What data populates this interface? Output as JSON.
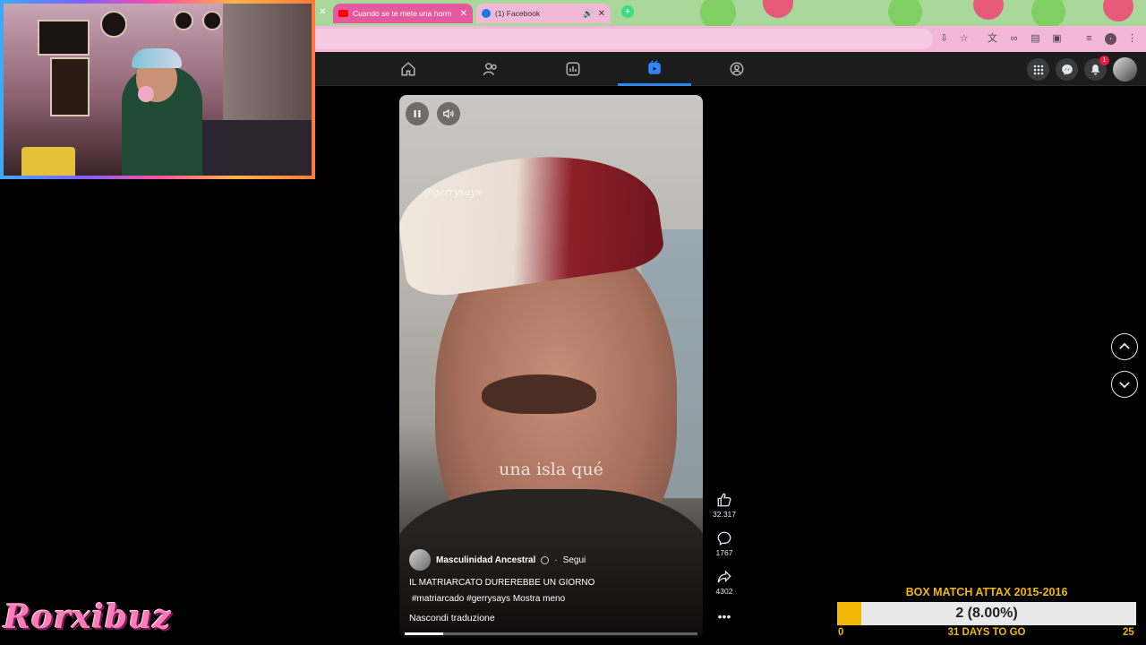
{
  "browser": {
    "tabs": [
      {
        "title": "Cuando se te mete una horm",
        "active": true,
        "icon": "youtube-icon"
      },
      {
        "title": "(1) Facebook",
        "active": false,
        "icon": "facebook-icon"
      }
    ]
  },
  "facebook": {
    "notification_count": "1",
    "nav": [
      "home-icon",
      "friends-icon",
      "feeds-icon",
      "reels-icon",
      "groups-icon"
    ],
    "active_nav": "reels-icon"
  },
  "reel": {
    "watermark": "@gerrysays",
    "subtitle": "una isla qué",
    "author": "Masculinidad Ancestral",
    "follow": "Segui",
    "description": "IL MATRIARCATO DUREREBBE UN GIORNO",
    "tags": "#matriarcado #gerrysays",
    "show_less": "Mostra meno",
    "hide_translation": "Nascondi traduzione",
    "progress": 0.13,
    "likes": "32.317",
    "comments": "1767",
    "shares": "4302"
  },
  "overlay": {
    "streamer_logo": "Rorxibuz",
    "goal_title": "BOX MATCH ATTAX 2015-2016",
    "goal_progress_text": "2 (8.00%)",
    "goal_fraction": 0.08,
    "goal_start": "0",
    "goal_days": "31 DAYS TO GO",
    "goal_end": "25"
  },
  "colors": {
    "facebook_blue": "#2d88ff",
    "goal_gold": "#f2b705",
    "logo_pink": "#ff7ab8"
  }
}
